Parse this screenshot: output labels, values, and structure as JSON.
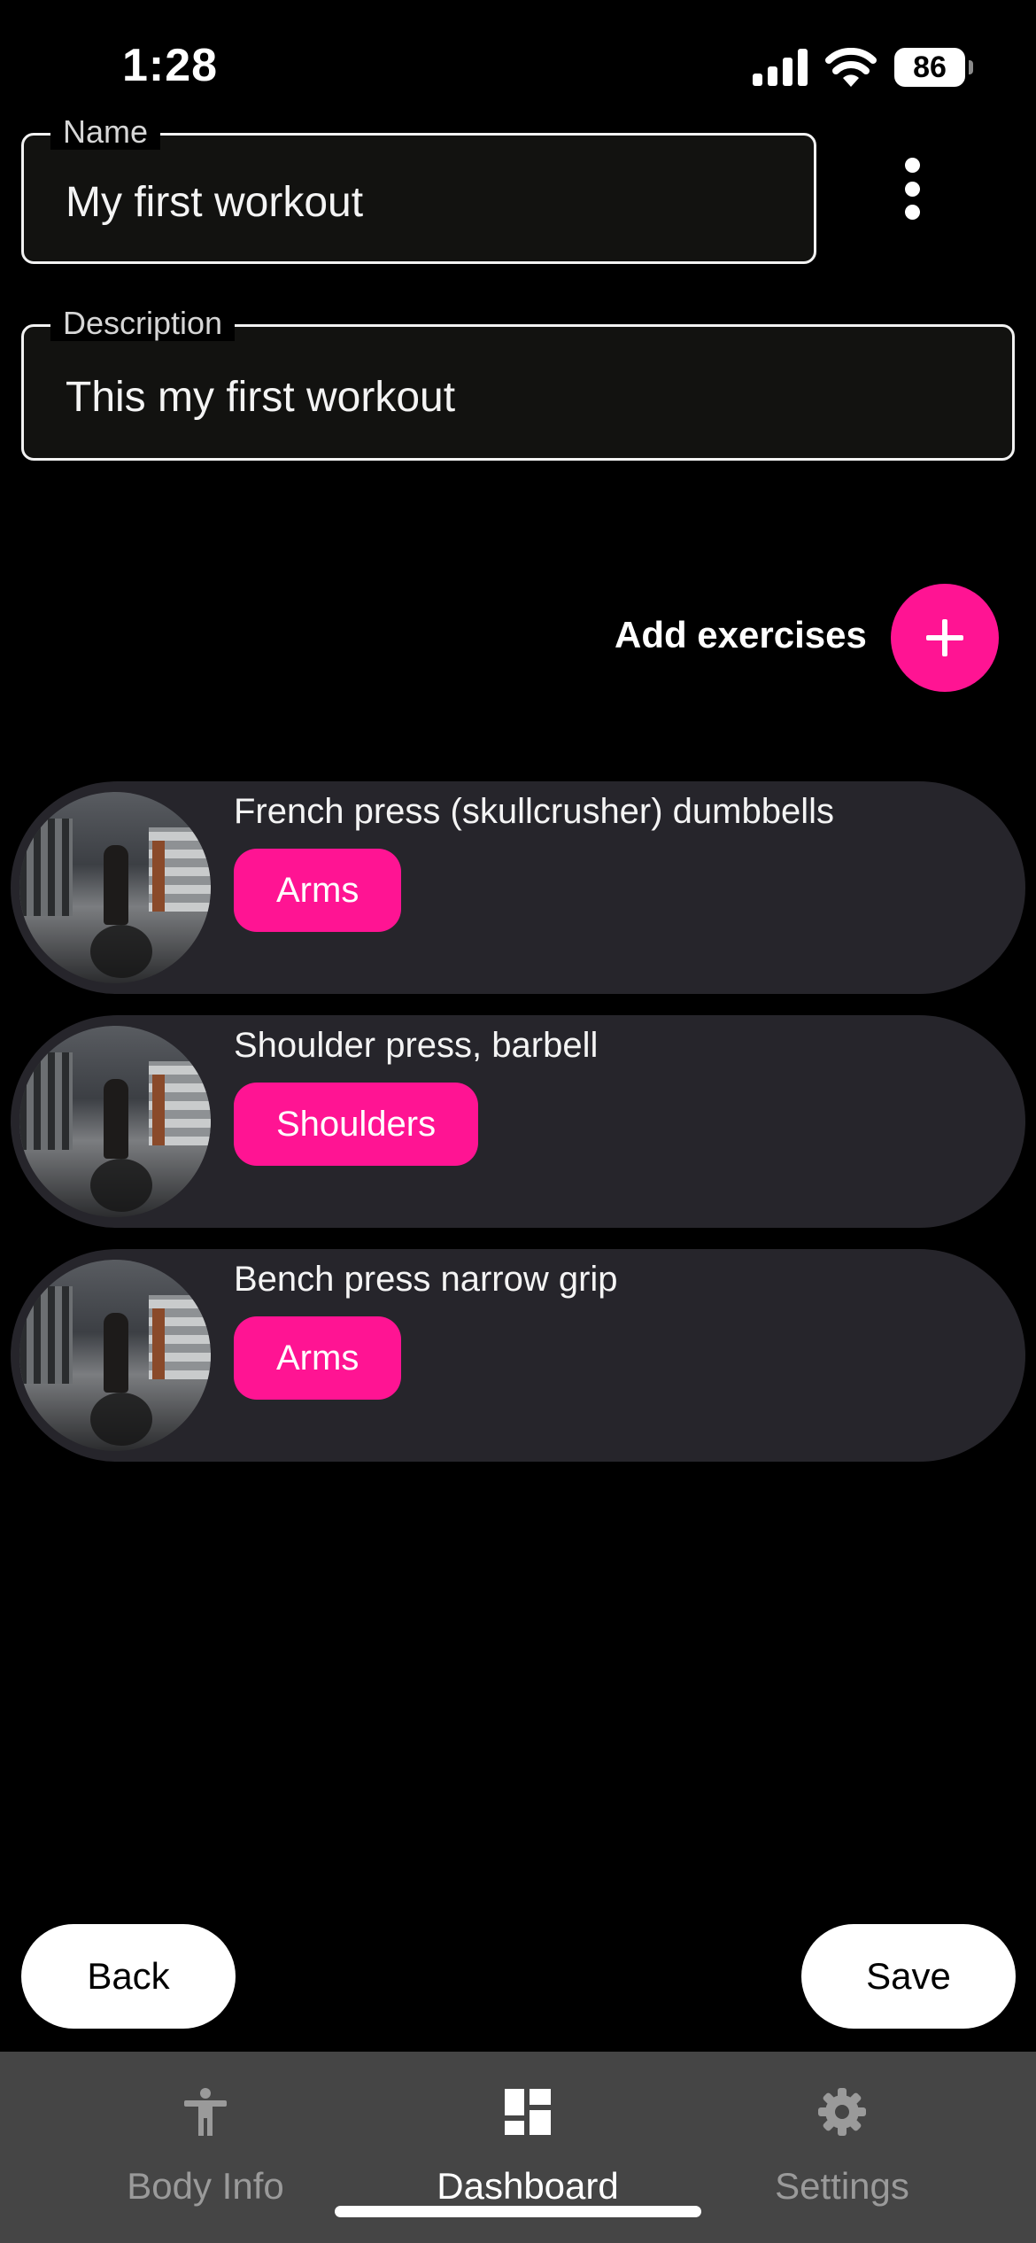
{
  "status_bar": {
    "time": "1:28",
    "battery": "86",
    "icons": [
      "signal-icon",
      "wifi-icon",
      "battery-icon"
    ]
  },
  "form": {
    "name": {
      "label": "Name",
      "value": "My first workout"
    },
    "description": {
      "label": "Description",
      "value": "This my first workout"
    },
    "more_icon": "more-vertical-icon"
  },
  "add_exercises": {
    "label": "Add exercises",
    "icon": "plus-icon"
  },
  "exercises": [
    {
      "name": "French press (skullcrusher) dumbbells",
      "muscle": "Arms"
    },
    {
      "name": "Shoulder press, barbell",
      "muscle": "Shoulders"
    },
    {
      "name": "Bench press narrow grip",
      "muscle": "Arms"
    }
  ],
  "actions": {
    "back_label": "Back",
    "save_label": "Save"
  },
  "bottom_nav": {
    "items": [
      {
        "label": "Body Info",
        "icon": "person-icon",
        "active": false
      },
      {
        "label": "Dashboard",
        "icon": "dashboard-icon",
        "active": true
      },
      {
        "label": "Settings",
        "icon": "gear-icon",
        "active": false
      }
    ]
  },
  "colors": {
    "accent": "#ff1493",
    "background": "#000000",
    "card": "#26252b",
    "nav_background": "#454545"
  }
}
